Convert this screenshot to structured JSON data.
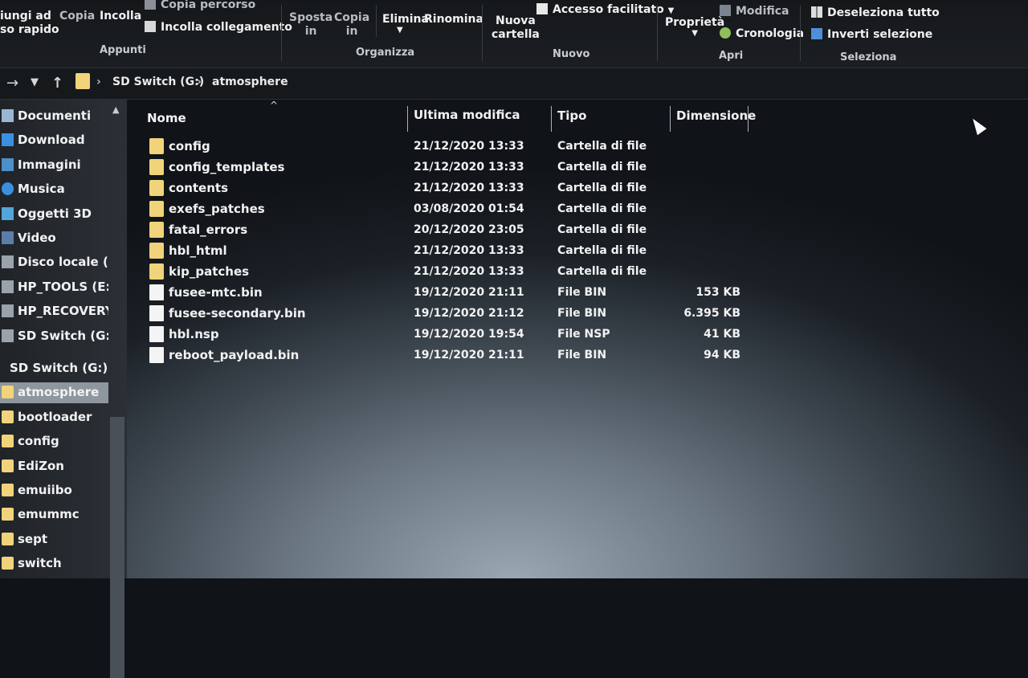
{
  "ribbon": {
    "appunti": {
      "pin_line1": "iungi ad",
      "pin_line2": "so rapido",
      "copia": "Copia",
      "incolla": "Incolla",
      "copia_percorso": "Copia percorso",
      "incolla_collegamento": "Incolla collegamento",
      "group_label": "Appunti"
    },
    "organizza": {
      "sposta_line1": "Sposta",
      "sposta_line2": "in",
      "copia_line1": "Copia",
      "copia_line2": "in",
      "elimina": "Elimina",
      "rinomina": "Rinomina",
      "group_label": "Organizza"
    },
    "nuovo": {
      "nuova_line1": "Nuova",
      "nuova_line2": "cartella",
      "accesso_facilitato": "Accesso facilitato",
      "group_label": "Nuovo"
    },
    "apri": {
      "proprieta": "Proprietà",
      "modifica": "Modifica",
      "cronologia": "Cronologia",
      "group_label": "Apri"
    },
    "seleziona": {
      "deseleziona_tutto": "Deseleziona tutto",
      "inverti_selezione": "Inverti selezione",
      "group_label": "Seleziona"
    }
  },
  "address": {
    "crumbs": [
      "SD Switch (G:)",
      "atmosphere"
    ]
  },
  "sidebar": {
    "items": [
      {
        "label": "Documenti",
        "icon": "documents-icon"
      },
      {
        "label": "Download",
        "icon": "download-icon"
      },
      {
        "label": "Immagini",
        "icon": "pictures-icon"
      },
      {
        "label": "Musica",
        "icon": "music-icon"
      },
      {
        "label": "Oggetti 3D",
        "icon": "3d-objects-icon"
      },
      {
        "label": "Video",
        "icon": "video-icon"
      },
      {
        "label": "Disco locale (C:)",
        "icon": "drive-icon"
      },
      {
        "label": "HP_TOOLS (E:)",
        "icon": "drive-icon"
      },
      {
        "label": "HP_RECOVERY (F",
        "icon": "drive-icon"
      },
      {
        "label": "SD Switch (G:)",
        "icon": "sd-drive-icon"
      },
      {
        "label": "SD Switch (G:)",
        "icon": "sd-drive-icon"
      },
      {
        "label": "atmosphere",
        "icon": "folder-icon",
        "selected": true
      },
      {
        "label": "bootloader",
        "icon": "folder-icon"
      },
      {
        "label": "config",
        "icon": "folder-icon"
      },
      {
        "label": "EdiZon",
        "icon": "folder-icon"
      },
      {
        "label": "emuiibo",
        "icon": "folder-icon"
      },
      {
        "label": "emummc",
        "icon": "folder-icon"
      },
      {
        "label": "sept",
        "icon": "folder-icon"
      },
      {
        "label": "switch",
        "icon": "folder-icon"
      }
    ]
  },
  "columns": {
    "name": "Nome",
    "modified": "Ultima modifica",
    "type": "Tipo",
    "size": "Dimensione"
  },
  "files": [
    {
      "name": "config",
      "modified": "21/12/2020 13:33",
      "type": "Cartella di file",
      "size": "",
      "kind": "folder"
    },
    {
      "name": "config_templates",
      "modified": "21/12/2020 13:33",
      "type": "Cartella di file",
      "size": "",
      "kind": "folder"
    },
    {
      "name": "contents",
      "modified": "21/12/2020 13:33",
      "type": "Cartella di file",
      "size": "",
      "kind": "folder"
    },
    {
      "name": "exefs_patches",
      "modified": "03/08/2020 01:54",
      "type": "Cartella di file",
      "size": "",
      "kind": "folder"
    },
    {
      "name": "fatal_errors",
      "modified": "20/12/2020 23:05",
      "type": "Cartella di file",
      "size": "",
      "kind": "folder"
    },
    {
      "name": "hbl_html",
      "modified": "21/12/2020 13:33",
      "type": "Cartella di file",
      "size": "",
      "kind": "folder"
    },
    {
      "name": "kip_patches",
      "modified": "21/12/2020 13:33",
      "type": "Cartella di file",
      "size": "",
      "kind": "folder"
    },
    {
      "name": "fusee-mtc.bin",
      "modified": "19/12/2020 21:11",
      "type": "File BIN",
      "size": "153 KB",
      "kind": "file"
    },
    {
      "name": "fusee-secondary.bin",
      "modified": "19/12/2020 21:12",
      "type": "File BIN",
      "size": "6.395 KB",
      "kind": "file"
    },
    {
      "name": "hbl.nsp",
      "modified": "19/12/2020 19:54",
      "type": "File NSP",
      "size": "41 KB",
      "kind": "file"
    },
    {
      "name": "reboot_payload.bin",
      "modified": "19/12/2020 21:11",
      "type": "File BIN",
      "size": "94 KB",
      "kind": "file"
    }
  ],
  "colors": {
    "folder": "#f0d37a",
    "selection": "#8e969e",
    "ribbon_bg": "#15181b"
  }
}
